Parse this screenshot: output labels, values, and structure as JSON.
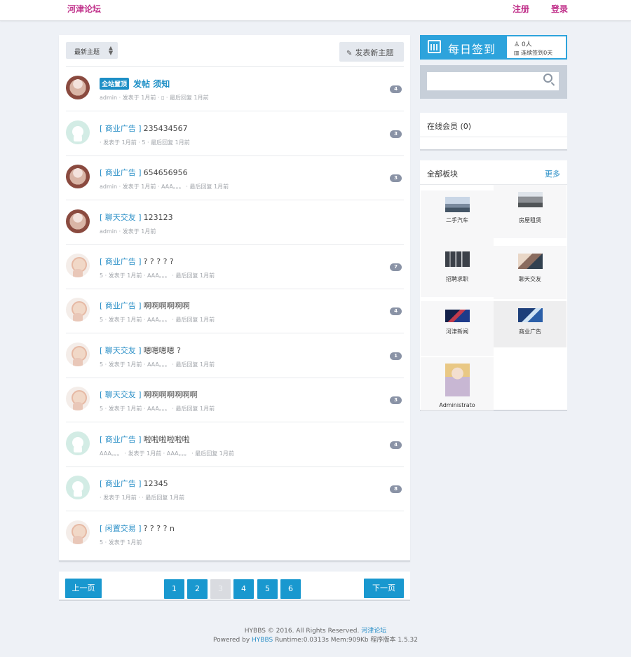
{
  "header": {
    "brand": "河津论坛",
    "register": "注册",
    "login": "登录"
  },
  "toolbar": {
    "sort_label": "最新主题",
    "new_post_label": "发表新主题"
  },
  "threads": [
    {
      "category": "",
      "pinned_badge": "全站置顶",
      "title": "发帖 须知",
      "meta": "admin · 发表于 1月前 · ▯ · 最后回复 1月前",
      "count": "4"
    },
    {
      "category": "[ 商业广告 ]",
      "title": "235434567",
      "meta": "· 发表于 1月前 · 5 · 最后回复 1月前",
      "count": "3"
    },
    {
      "category": "[ 商业广告 ]",
      "title": "654656956",
      "meta": "admin · 发表于 1月前 · AAA。。。 · 最后回复 1月前",
      "count": "3"
    },
    {
      "category": "[ 聊天交友 ]",
      "title": "123123",
      "meta": "admin · 发表于 1月前",
      "count": ""
    },
    {
      "category": "[ 商业广告 ]",
      "title": "? ? ? ? ?",
      "meta": "5 · 发表于 1月前 · AAA。。。 · 最后回复 1月前",
      "count": "7"
    },
    {
      "category": "[ 商业广告 ]",
      "title": "啊啊啊啊啊啊",
      "meta": "5 · 发表于 1月前 · AAA。。。 · 最后回复 1月前",
      "count": "4"
    },
    {
      "category": "[ 聊天交友 ]",
      "title": "嗯嗯嗯嗯 ?",
      "meta": "5 · 发表于 1月前 · AAA。。。 · 最后回复 1月前",
      "count": "1"
    },
    {
      "category": "[ 聊天交友 ]",
      "title": "啊啊啊啊啊啊啊",
      "meta": "5 · 发表于 1月前 · AAA。。。 · 最后回复 1月前",
      "count": "3"
    },
    {
      "category": "[ 商业广告 ]",
      "title": "啦啦啦啦啦啦",
      "meta": "AAA。。。 · 发表于 1月前 · AAA。。。 · 最后回复 1月前",
      "count": "4"
    },
    {
      "category": "[ 商业广告 ]",
      "title": "12345",
      "meta": "· 发表于 1月前 · · 最后回复 1月前",
      "count": "8"
    },
    {
      "category": "[ 闲置交易 ]",
      "title": "? ? ? ? n",
      "meta": "5 · 发表于 1月前",
      "count": ""
    }
  ],
  "pager": {
    "prev": "上一页",
    "next": "下一页",
    "pages": [
      "1",
      "2",
      "3",
      "4",
      "5",
      "6"
    ],
    "current": "3"
  },
  "sidebar": {
    "checkin_label": "每日签到",
    "checkin_people": "0人",
    "checkin_streak": "连续签到0天",
    "search_placeholder": "",
    "online_title": "在线会员 (0)",
    "boards_title": "全部板块",
    "boards_more": "更多",
    "boards": [
      "二手汽车",
      "房屋租赁",
      "招聘求职",
      "聊天交友",
      "河津新闻",
      "商业广告",
      "Administrato"
    ]
  },
  "footer": {
    "line1_prefix": "HYBBS © 2016. All Rights Reserved.",
    "line1_link": "河津论坛",
    "line2_prefix": "Powered by",
    "line2_link": "HYBBS",
    "line2_suffix": "Runtime:0.0313s Mem:909Kb 程序版本 1.5.32"
  },
  "colors": {
    "accent": "#2da3dc",
    "brand": "#c0308a",
    "button": "#1998cf"
  }
}
